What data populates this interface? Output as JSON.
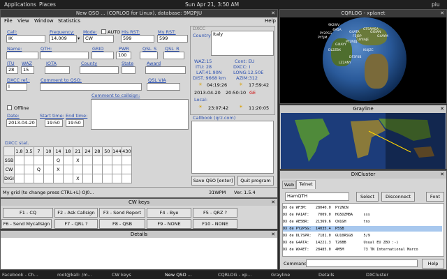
{
  "topbar": {
    "applications": "Applications",
    "places": "Places",
    "datetime": "Sun Apr 21, 3:50 AM",
    "user": "piu"
  },
  "main": {
    "title": "New QSO ... (CQRLOG for Linux), database: 9M2PJU",
    "close": "✕",
    "menu": [
      "File",
      "View",
      "Window",
      "Statistics"
    ],
    "help": "Help",
    "labels": {
      "call": "Call:",
      "freq": "Frequency:",
      "mode": "Mode:",
      "auto": "AUTO",
      "his_rst": "His RST:",
      "my_rst": "My RST:",
      "name": "Name:",
      "qth": "QTH:",
      "grid": "GRID",
      "pwr": "PWR",
      "qsl_s": "QSL_S",
      "qsl_r": "QSL_R",
      "itu": "ITU",
      "waz": "WAZ",
      "iota": "IOTA",
      "county": "County",
      "state": "State",
      "award": "Award",
      "dxcc_ref": "DXCC ref.:",
      "comment_qso": "Comment to QSO:",
      "qsl_via": "QSL VIA",
      "comment_call": "Comment to callsign:",
      "offline": "Offline",
      "date": "Date:",
      "start": "Start time:",
      "end": "End time:",
      "dxcc_stat": "DXCC stat."
    },
    "values": {
      "call": "IK",
      "freq": "14.009",
      "mode": "CW",
      "his_rst": "599",
      "my_rst": "599",
      "pwr": "100",
      "itu": "28",
      "waz": "15",
      "dxcc_ref": "I",
      "date": "2013-04-20",
      "start": "19:50",
      "end": "19:50"
    },
    "info": {
      "dxcc_head": "DXCC",
      "country_lbl": "Country:",
      "country": "Italy",
      "waz": "WAZ:15",
      "cont": "Cont: EU",
      "itu": "ITU: 28",
      "dxcc": "DXCC: I",
      "lat": "LAT:41.90N",
      "long": "LONG:12.50E",
      "dist": "DIST.:9668 km",
      "azim": "AZIM:312",
      "sunrise": "04:19:26",
      "sunset": "17:59:42",
      "last_date": "2013-04-20",
      "last_time": "20:50:10",
      "ge": "GE",
      "local_lbl": "Local:",
      "local_rise": "23:07:42",
      "local_set": "11:20:05",
      "callbook": "Callbook (qrz.com)"
    },
    "dxcc_table": {
      "bands": [
        "",
        "1.8",
        "3.5",
        "7",
        "10",
        "14",
        "18",
        "21",
        "24",
        "28",
        "50",
        "144",
        "430"
      ],
      "rows": [
        {
          "mode": "SSB",
          "cells": [
            "",
            "",
            "",
            "",
            "Q",
            "",
            "X",
            "",
            "",
            "",
            "",
            ""
          ]
        },
        {
          "mode": "CW",
          "cells": [
            "",
            "",
            "Q",
            "",
            "X",
            "",
            "",
            "",
            "",
            "",
            "",
            ""
          ]
        },
        {
          "mode": "DIGI",
          "cells": [
            "",
            "",
            "",
            "",
            "",
            "",
            "X",
            "",
            "",
            "",
            "",
            ""
          ]
        }
      ]
    },
    "buttons": {
      "save": "Save QSO [enter]",
      "quit": "Quit program"
    },
    "status": {
      "grid": "My grid (to change press CTRL+L) OJ0...",
      "wpm": "31WPM",
      "ver": "Ver. 1.5.4"
    }
  },
  "cw": {
    "title": "CW keys",
    "keys": [
      "F1 - CQ",
      "F2 - Ask Callsign",
      "F3 - Send Report",
      "F4 - Bye",
      "F5 - QRZ ?",
      "F6 - Send Mycallsign",
      "F7 - QRL ?",
      "F8 - QSB",
      "F9 - NONE",
      "F10 - NONE"
    ]
  },
  "details": {
    "title": "Details"
  },
  "xplanet": {
    "title": "CQRLOG - xplanet",
    "labels": [
      "9K2WV",
      "4M5A",
      "PY2PSG",
      "PY5JM",
      "GT5AMSA",
      "G4ATA",
      "F5JBP",
      "UY4AJE",
      "GI6IAN",
      "G4AYM",
      "PY2NDJ",
      "GI4AYY",
      "DL2ZBX",
      "IK4JZC",
      "DF3F0B",
      "LZ2ANY"
    ]
  },
  "grayline": {
    "title": "Grayline"
  },
  "dxcluster": {
    "title": "DXCluster",
    "tabs": [
      "Web",
      "Telnet"
    ],
    "input": "HamQTH",
    "select": "Select",
    "disconnect": "Disconnect",
    "font": "Font",
    "command_lbl": "Command:",
    "help": "Help",
    "spots": [
      "DX de WF3M:    28040.0  PY2NCN",
      "DX de PA1AT:    7009.0  HG5DZMBA     sss",
      "DX de AE5BR:   21369.6  CW1GH        tnx",
      "DX de PY2PSG:  14035.4  P5SB",
      "DX de DL7SPR:   7181.0  GU10RSGB     5/9",
      "DX de G4ATA:   14221.3  T26BB        Usual EU ZBO :-)",
      "DX de WX4ET:   28485.0  4M5M         73 TN International Marco"
    ]
  },
  "taskbar": [
    "Facebook - Ch...",
    "root@kali: /m...",
    "CW keys",
    "New QSO ...",
    "CQRLOG - xp...",
    "Grayline",
    "Details",
    "DXCluster"
  ]
}
